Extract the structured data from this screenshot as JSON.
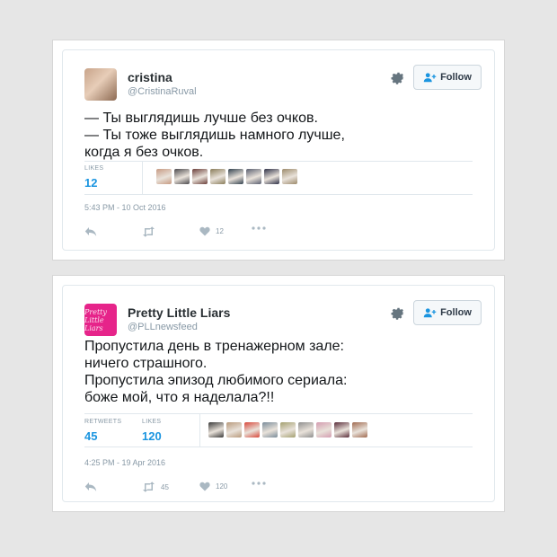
{
  "tweets": [
    {
      "author_name": "cristina",
      "author_handle": "@CristinaRuval",
      "follow_label": "Follow",
      "text": "— Ты выглядишь лучше без очков.\n— Ты тоже выглядишь намного лучше,\nкогда я без очков.",
      "likes_label": "LIKES",
      "likes_count": "12",
      "timestamp": "5:43 PM - 10 Oct 2016",
      "action_like_count": "12",
      "liker_colors": [
        "#c79a82",
        "#4c4a4e",
        "#6b3f3a",
        "#8a7d5a",
        "#33424f",
        "#5a5f70",
        "#2f3148",
        "#9c8a6b"
      ]
    },
    {
      "author_name": "Pretty Little Liars",
      "author_handle": "@PLLnewsfeed",
      "avatar_text": "Pretty Little Liars",
      "follow_label": "Follow",
      "text": "Пропустила день в тренажерном зале:\nничего страшного.\nПропустила эпизод любимого сериала:\nбоже мой, что я наделала?!!",
      "retweets_label": "RETWEETS",
      "retweets_count": "45",
      "likes_label": "LIKES",
      "likes_count": "120",
      "timestamp": "4:25 PM - 19 Apr 2016",
      "action_retweet_count": "45",
      "action_like_count": "120",
      "liker_colors": [
        "#3a3a3a",
        "#b89a7c",
        "#d8483b",
        "#7a8c9a",
        "#a4a070",
        "#8f8f8f",
        "#d49cb0",
        "#5a2d3a",
        "#a06a50"
      ]
    }
  ]
}
